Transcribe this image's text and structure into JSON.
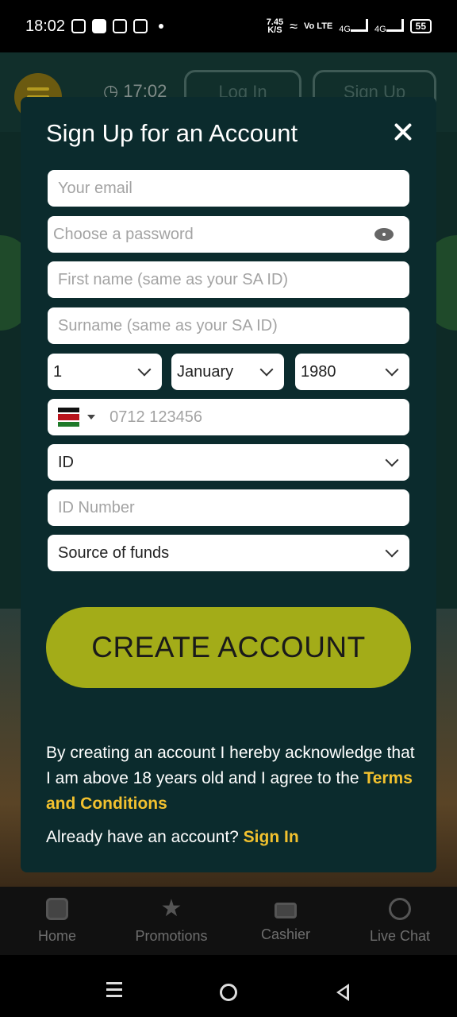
{
  "status_bar": {
    "time": "18:02",
    "network_speed": "7.45",
    "network_speed_unit": "K/S",
    "volte": "Vo LTE",
    "net1": "4G",
    "net2": "4G",
    "battery": "55"
  },
  "background": {
    "clock": "17:02",
    "login_label": "Log In",
    "signup_label": "Sign Up"
  },
  "modal": {
    "title": "Sign Up for an Account",
    "email_placeholder": "Your email",
    "password_placeholder": "Choose a password",
    "first_name_placeholder": "First name (same as your SA ID)",
    "surname_placeholder": "Surname (same as your SA ID)",
    "dob": {
      "day": "1",
      "month": "January",
      "year": "1980"
    },
    "phone_placeholder": "0712 123456",
    "id_type": "ID",
    "id_number_placeholder": "ID Number",
    "source_of_funds": "Source of funds",
    "create_button": "CREATE ACCOUNT",
    "legal_text": "By creating an account I hereby acknowledge that I am above 18 years old and I agree to the ",
    "terms_link": "Terms and Conditions",
    "already_text": "Already have an account? ",
    "signin_link": "Sign In"
  },
  "bottom_nav": {
    "items": [
      {
        "label": "Home",
        "icon": "dice-icon"
      },
      {
        "label": "Promotions",
        "icon": "star-icon"
      },
      {
        "label": "Cashier",
        "icon": "card-icon"
      },
      {
        "label": "Live Chat",
        "icon": "headset-icon"
      }
    ]
  },
  "colors": {
    "modal_bg": "#0b2b2d",
    "accent_button": "#a3ac18",
    "link": "#f2c12e"
  }
}
